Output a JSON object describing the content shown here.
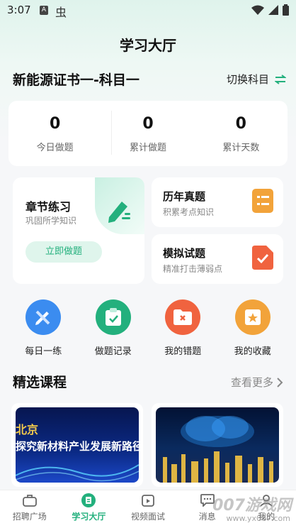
{
  "status_bar": {
    "time": "3:07",
    "icon_a": "A",
    "icon_b": "虫"
  },
  "header": {
    "title": "学习大厅"
  },
  "subject": {
    "name": "新能源证书一-科目一",
    "switch_label": "切换科目"
  },
  "stats": [
    {
      "value": "0",
      "label": "今日做题"
    },
    {
      "value": "0",
      "label": "累计做题"
    },
    {
      "value": "0",
      "label": "累计天数"
    }
  ],
  "chapter": {
    "title": "章节练习",
    "subtitle": "巩固所学知识",
    "button": "立即做题"
  },
  "past_exams": {
    "title": "历年真题",
    "subtitle": "积累考点知识"
  },
  "mock_exams": {
    "title": "模拟试题",
    "subtitle": "精准打击薄弱点"
  },
  "quick_actions": [
    {
      "label": "每日一练",
      "icon": "pencil-ruler-icon",
      "color": "#3b8cf0"
    },
    {
      "label": "做题记录",
      "icon": "clipboard-check-icon",
      "color": "#23b07d"
    },
    {
      "label": "我的错题",
      "icon": "folder-x-icon",
      "color": "#f0633f"
    },
    {
      "label": "我的收藏",
      "icon": "star-box-icon",
      "color": "#f2a33a"
    }
  ],
  "courses": {
    "title": "精选课程",
    "see_more": "查看更多",
    "items": [
      {
        "line1": "北京",
        "line2": "探究新材料产业发展新路径"
      },
      {
        "line1": "",
        "line2": ""
      }
    ]
  },
  "tabbar": [
    {
      "label": "招聘广场",
      "icon": "briefcase-icon",
      "active": false
    },
    {
      "label": "学习大厅",
      "icon": "book-icon",
      "active": true
    },
    {
      "label": "视频面试",
      "icon": "video-icon",
      "active": false
    },
    {
      "label": "消息",
      "icon": "chat-icon",
      "active": false
    },
    {
      "label": "我的",
      "icon": "user-icon",
      "active": false
    }
  ],
  "watermark": {
    "text": "007游戏网",
    "url": "www.yx007.com"
  },
  "colors": {
    "accent": "#23b07d",
    "orange": "#f2a33a"
  }
}
